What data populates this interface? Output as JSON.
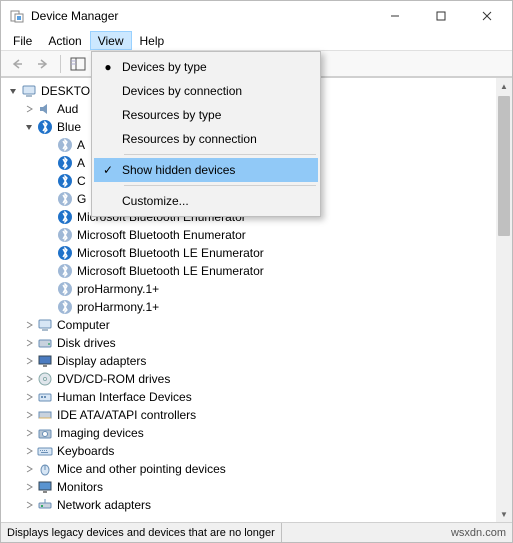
{
  "window": {
    "title": "Device Manager"
  },
  "menus": {
    "file": "File",
    "action": "Action",
    "view": "View",
    "help": "Help"
  },
  "view_menu": {
    "devices_by_type": "Devices by type",
    "devices_by_connection": "Devices by connection",
    "resources_by_type": "Resources by type",
    "resources_by_connection": "Resources by connection",
    "show_hidden_devices": "Show hidden devices",
    "customize": "Customize..."
  },
  "tree": {
    "root": "DESKTO",
    "audio": "Aud",
    "bluetooth": "Blue",
    "bt_items": {
      "a1": "A",
      "a2": "A",
      "c": "C",
      "g": "G",
      "mbe1": "Microsoft Bluetooth Enumerator",
      "mbe2": "Microsoft Bluetooth Enumerator",
      "mble1": "Microsoft Bluetooth LE Enumerator",
      "mble2": "Microsoft Bluetooth LE Enumerator",
      "ph1": "proHarmony.1+",
      "ph2": "proHarmony.1+"
    },
    "computer": "Computer",
    "disk_drives": "Disk drives",
    "display_adapters": "Display adapters",
    "dvd": "DVD/CD-ROM drives",
    "hid": "Human Interface Devices",
    "ide": "IDE ATA/ATAPI controllers",
    "imaging": "Imaging devices",
    "keyboards": "Keyboards",
    "mice": "Mice and other pointing devices",
    "monitors": "Monitors",
    "network": "Network adapters"
  },
  "status": {
    "left": "Displays legacy devices and devices that are no longer",
    "right": "wsxdn.com"
  },
  "colors": {
    "bt_active": "#2072c9",
    "bt_faded": "#9fb8d6"
  }
}
